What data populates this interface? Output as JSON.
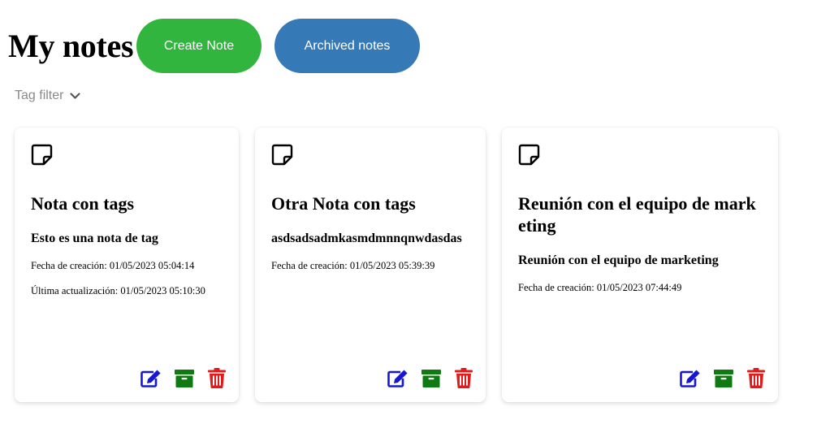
{
  "header": {
    "title": "My notes",
    "create_label": "Create Note",
    "archived_label": "Archived notes"
  },
  "filter": {
    "label": "Tag filter"
  },
  "colors": {
    "create_button": "#31b53f",
    "archived_button": "#357ab7",
    "edit_icon": "#1616d6",
    "archive_icon": "#0f7a12",
    "delete_icon": "#e11b1b"
  },
  "notes": [
    {
      "title": "Nota con tags",
      "content": "Esto es una nota de tag",
      "created": "Fecha de creación: 01/05/2023 05:04:14",
      "updated": "Última actualización: 01/05/2023 05:10:30"
    },
    {
      "title": "Otra Nota con tags",
      "content": "asdsadsadmkasmdmnnqnwdasdas",
      "created": "Fecha de creación: 01/05/2023 05:39:39"
    },
    {
      "title": "Reunión con el equipo de marketing",
      "content": "Reunión con el equipo de marketing",
      "created": "Fecha de creación: 01/05/2023 07:44:49"
    }
  ],
  "icons": {
    "note": "sticky-note-icon",
    "filter_toggle": "chevron-down-icon",
    "edit": "edit-icon",
    "archive": "archive-icon",
    "delete": "trash-icon"
  }
}
